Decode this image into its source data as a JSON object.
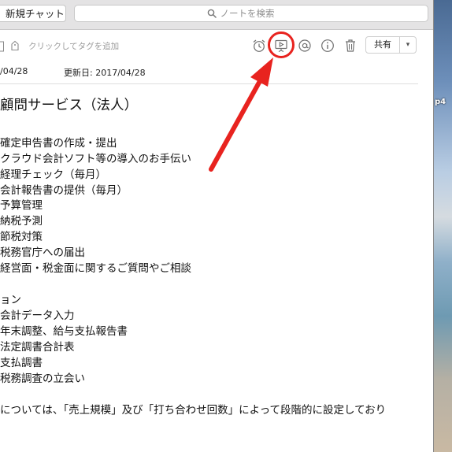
{
  "toolbar": {
    "new_chat_label": "新規チャット",
    "search_placeholder": "ノートを検索"
  },
  "note_header": {
    "add_tag_text": "クリックしてタグを追加",
    "share_label": "共有"
  },
  "dates": {
    "created": "/04/28",
    "updated": "更新日: 2017/04/28"
  },
  "note": {
    "title": "顧問サービス（法人）",
    "items_group_1": [
      "確定申告書の作成・提出",
      "クラウド会計ソフト等の導入のお手伝い",
      "経理チェック（毎月）",
      "会計報告書の提供（毎月）",
      "予算管理",
      "納税予測",
      "節税対策",
      "税務官庁への届出",
      "経営面・税金面に関するご質問やご相談"
    ],
    "section_2": "ョン",
    "items_group_2": [
      "会計データ入力",
      "年末調整、給与支払報告書",
      "法定調書合計表",
      "支払調書",
      "税務調査の立会い"
    ],
    "footer_text": "については、「売上規模」及び「打ち合わせ回数」によって段階的に設定しており"
  },
  "desktop": {
    "label": "p4"
  },
  "colors": {
    "annotation_red": "#e8231f",
    "toolbar_bg": "#e4e3e4"
  }
}
